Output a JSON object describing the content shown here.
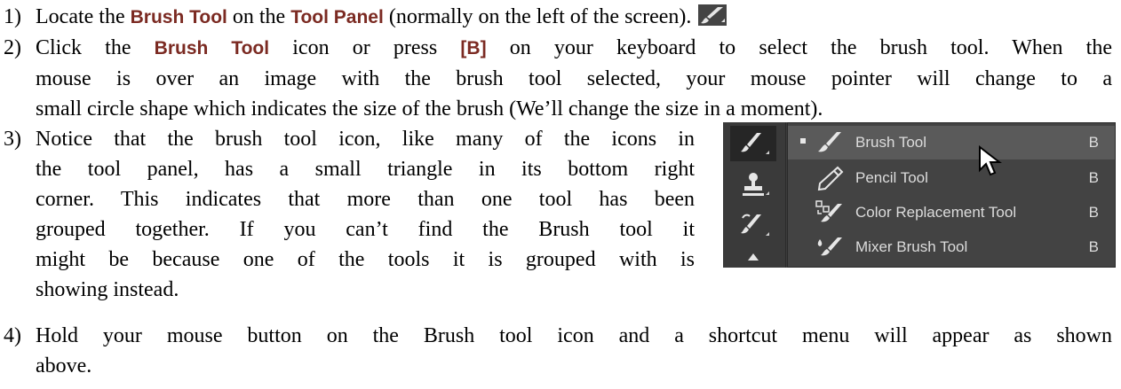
{
  "doc": {
    "steps": [
      {
        "number": "1)",
        "parts": [
          "Locate the ",
          "Brush Tool",
          " on the ",
          "Tool Panel",
          " (normally on the left of the screen)."
        ]
      },
      {
        "number": "2)",
        "line1": [
          "Click the ",
          "Brush Tool",
          " icon or press ",
          "[B]",
          " on your keyboard to select the brush tool. When the"
        ],
        "line2": "mouse is over an image with the brush tool selected, your mouse pointer will change to a",
        "line3": "small circle shape which indicates the size of the brush (We’ll change the size in a moment)."
      },
      {
        "number": "3)",
        "lines": [
          "Notice that the brush tool icon, like many of the icons in",
          "the tool panel, has a small triangle in its bottom right",
          "corner. This indicates that more than one tool has been",
          "grouped together. If you can’t find the Brush tool it",
          "might be because one of the tools it is grouped with is",
          "showing instead."
        ]
      },
      {
        "number": "4)",
        "line1": "Hold your mouse button on the Brush tool icon and a shortcut menu will appear as shown",
        "line2": "above."
      }
    ]
  },
  "screenshot": {
    "menu_items": [
      {
        "label": "Brush Tool",
        "shortcut": "B",
        "icon": "brush-icon",
        "active": true
      },
      {
        "label": "Pencil Tool",
        "shortcut": "B",
        "icon": "pencil-icon",
        "active": false
      },
      {
        "label": "Color Replacement Tool",
        "shortcut": "B",
        "icon": "color-replacement-icon",
        "active": false
      },
      {
        "label": "Mixer Brush Tool",
        "shortcut": "B",
        "icon": "mixer-brush-icon",
        "active": false
      }
    ],
    "tool_icons": [
      "brush-icon",
      "clone-stamp-icon",
      "history-brush-icon"
    ],
    "colors": {
      "panel_bg": "#3c3c3c",
      "menu_bg": "#434343",
      "highlight": "#5a5a5a",
      "keyword": "#7b2a22"
    }
  }
}
